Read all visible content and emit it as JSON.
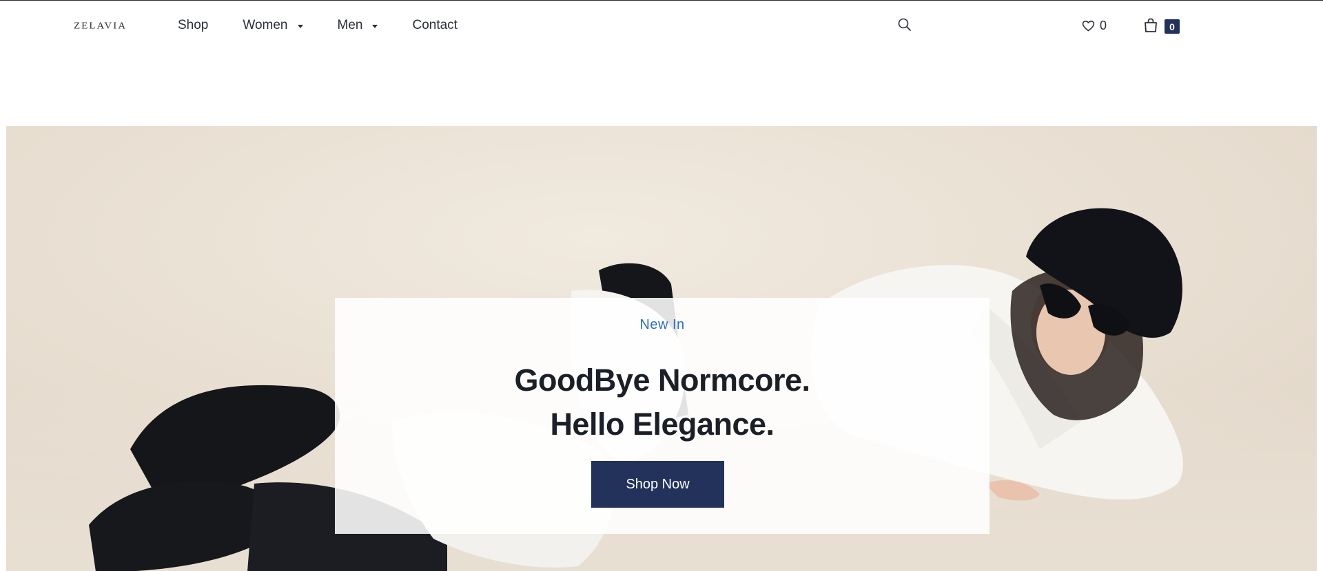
{
  "brand": {
    "logo_text": "ZELAVIA"
  },
  "nav": {
    "items": [
      {
        "label": "Shop",
        "has_dropdown": false
      },
      {
        "label": "Women",
        "has_dropdown": true
      },
      {
        "label": "Men",
        "has_dropdown": true
      },
      {
        "label": "Contact",
        "has_dropdown": false
      }
    ]
  },
  "header_actions": {
    "search_icon": "search-icon",
    "wishlist_icon": "heart-icon",
    "wishlist_count": "0",
    "cart_icon": "shopping-bag-icon",
    "cart_count": "0"
  },
  "hero": {
    "eyebrow": "New In",
    "headline_line1": "GoodBye Normcore.",
    "headline_line2": "Hello Elegance.",
    "cta_label": "Shop Now"
  },
  "colors": {
    "accent_navy": "#22325a",
    "eyebrow_blue": "#2e6fb8",
    "hero_background": "#ebe2d6"
  }
}
